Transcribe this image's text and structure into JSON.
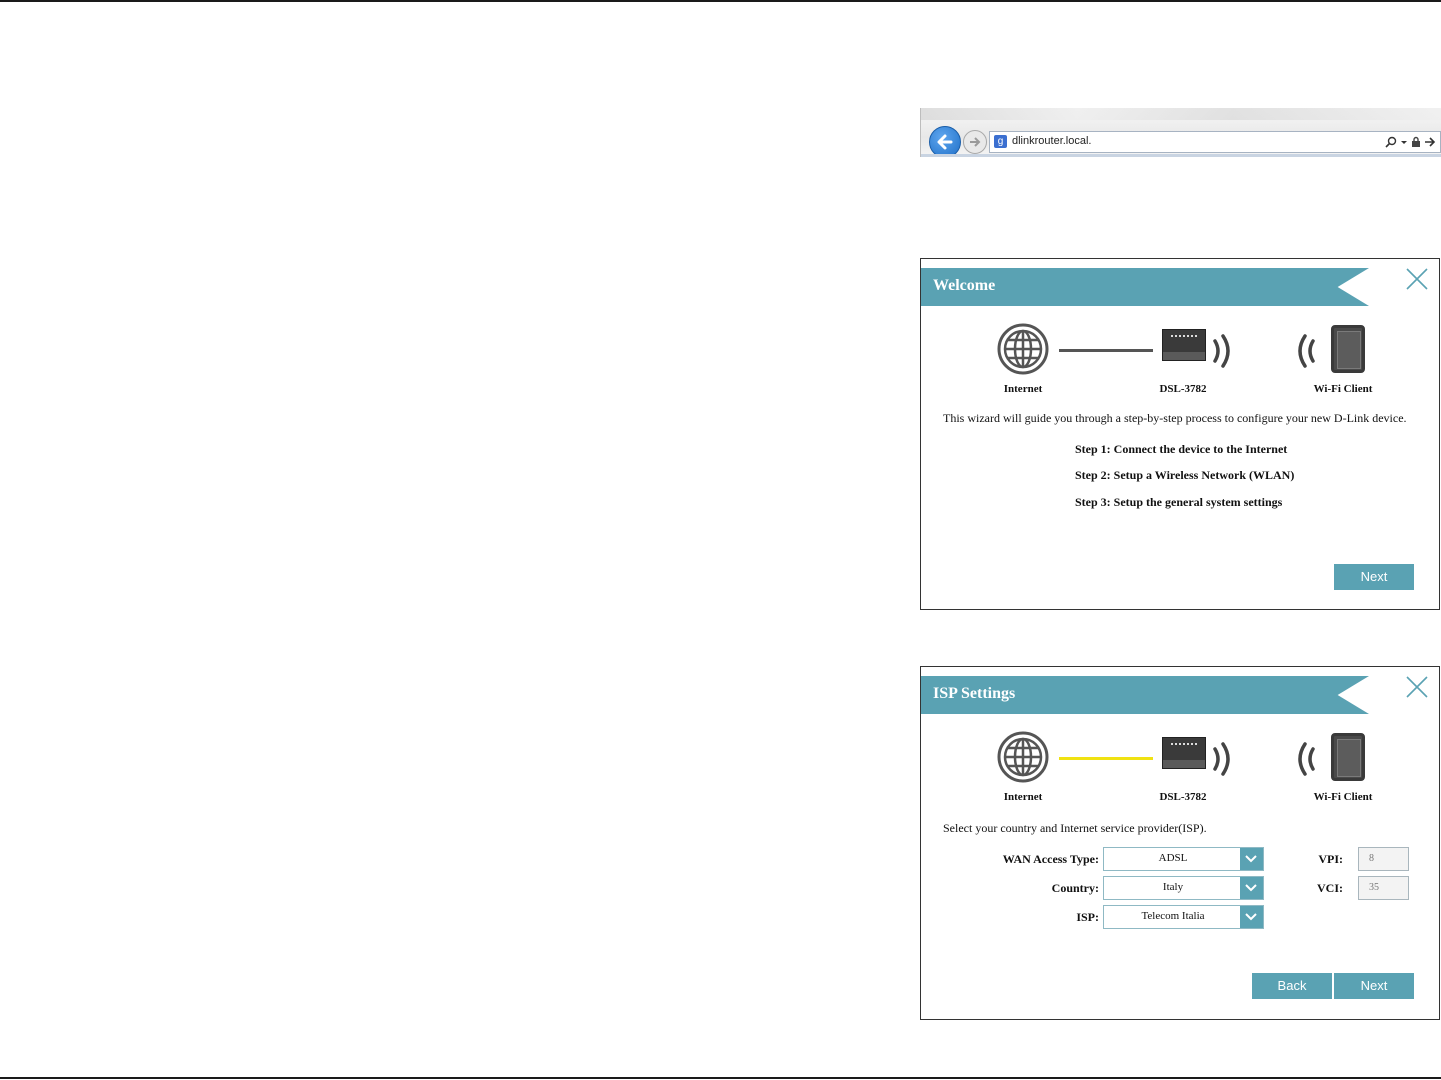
{
  "browser": {
    "url": "dlinkrouter.local.",
    "favicon_letter": "g",
    "icons": [
      "back-arrow-icon",
      "forward-icon",
      "search-icon",
      "dropdown-icon",
      "lock-icon",
      "go-arrow-icon"
    ]
  },
  "welcome": {
    "title": "Welcome",
    "diagram": {
      "internet_label": "Internet",
      "router_label": "DSL-3782",
      "client_label": "Wi-Fi Client"
    },
    "intro": "This wizard will guide you through a step-by-step process to configure your new D-Link device.",
    "steps": [
      "Step 1: Connect the device to the Internet",
      "Step 2: Setup a Wireless Network (WLAN)",
      "Step 3: Setup the general system settings"
    ],
    "next_label": "Next",
    "colors": {
      "accent": "#5aa2b3",
      "link_line": "#555555"
    }
  },
  "isp": {
    "title": "ISP Settings",
    "diagram": {
      "internet_label": "Internet",
      "router_label": "DSL-3782",
      "client_label": "Wi-Fi Client"
    },
    "intro": "Select your country and Internet service provider(ISP).",
    "wan_access_type_label": "WAN Access Type:",
    "wan_access_type_value": "ADSL",
    "country_label": "Country:",
    "country_value": "Italy",
    "isp_label": "ISP:",
    "isp_value": "Telecom Italia",
    "vpi_label": "VPI:",
    "vpi_value": "8",
    "vci_label": "VCI:",
    "vci_value": "35",
    "back_label": "Back",
    "next_label": "Next",
    "colors": {
      "accent": "#5aa2b3",
      "link_line": "#f0e212"
    }
  }
}
